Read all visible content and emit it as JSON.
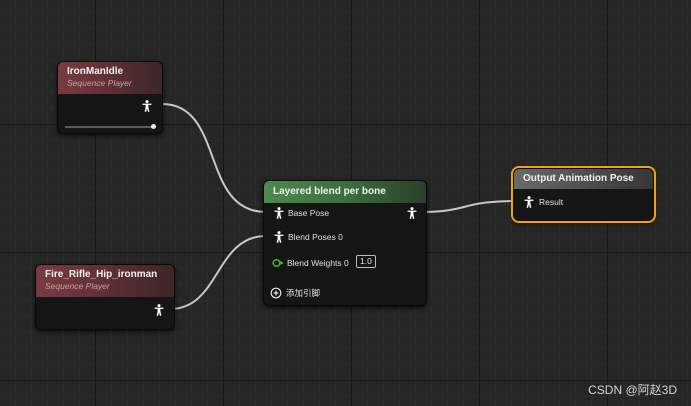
{
  "nodes": {
    "ironman_idle": {
      "title": "IronManIdle",
      "subtitle": "Sequence Player"
    },
    "fire_rifle": {
      "title": "Fire_Rifle_Hip_ironman",
      "subtitle": "Sequence Player"
    },
    "layered_blend": {
      "title": "Layered blend per bone",
      "base_pose_label": "Base Pose",
      "blend_poses_label": "Blend Poses 0",
      "blend_weights_label": "Blend Weights 0",
      "blend_weights_value": "1.0",
      "add_pin_label": "添加引脚"
    },
    "output_pose": {
      "title": "Output Animation Pose",
      "result_label": "Result"
    }
  },
  "colors": {
    "sequence_header": "#7a3b40",
    "blend_header": "#4c8a4f",
    "output_header": "#6a6a6a",
    "selection_outline": "#f0a500",
    "float_pin": "#4dbb3a",
    "wire": "#c8c8c8"
  },
  "icons": {
    "pose_pin": "person-pose-icon",
    "float_pin": "float-pin-icon",
    "add_pin": "add-pin-icon"
  },
  "watermark": "CSDN @阿赵3D"
}
